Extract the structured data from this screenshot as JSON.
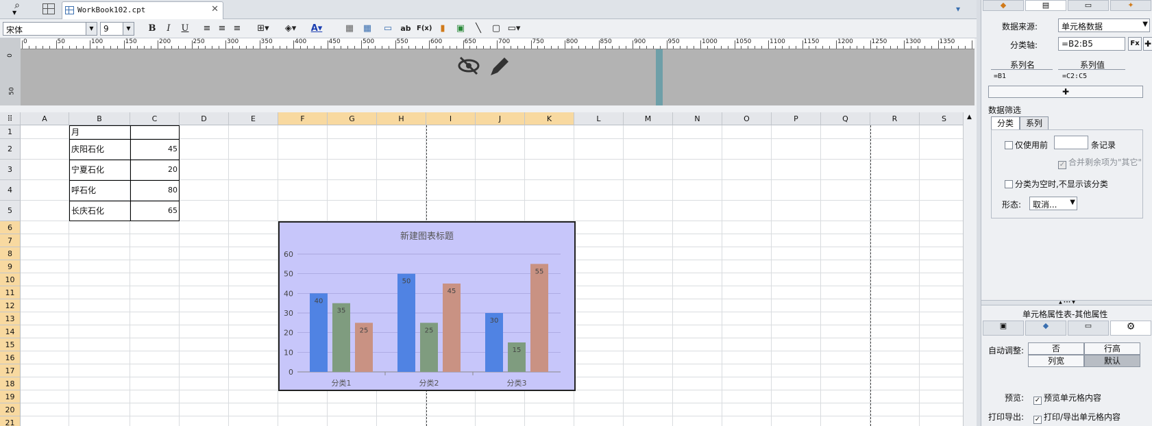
{
  "tab": {
    "title": "WorkBook102.cpt"
  },
  "toolbar": {
    "font": "宋体",
    "font_size": "9",
    "bold": "B",
    "italic": "I",
    "underline": "U",
    "text_ab": "ab",
    "formula": "F(x)"
  },
  "ruler": {
    "labels": [
      "0",
      "50",
      "100",
      "150",
      "200",
      "250",
      "300",
      "350",
      "400",
      "450",
      "500",
      "550",
      "600",
      "650",
      "700",
      "750",
      "800",
      "850",
      "900",
      "950",
      "1000",
      "1050",
      "1100",
      "1150",
      "1200",
      "1250",
      "1300",
      "1350"
    ],
    "v_labels": [
      "0",
      "50"
    ]
  },
  "columns": [
    "A",
    "B",
    "C",
    "D",
    "E",
    "F",
    "G",
    "H",
    "I",
    "J",
    "K",
    "L",
    "M",
    "N",
    "O",
    "P",
    "Q",
    "R",
    "S"
  ],
  "rows": [
    "1",
    "2",
    "3",
    "4",
    "5",
    "6",
    "7",
    "8",
    "9",
    "10",
    "11",
    "12",
    "13",
    "14",
    "15",
    "16",
    "17",
    "18",
    "19",
    "20",
    "21"
  ],
  "cells": {
    "b1": "月",
    "b2": "庆阳石化",
    "c2": "45",
    "b3": "宁夏石化",
    "c3": "20",
    "b4": "呼石化",
    "c4": "80",
    "b5": "长庆石化",
    "c5": "65"
  },
  "chart_data": {
    "type": "bar",
    "title": "新建图表标题",
    "categories": [
      "分类1",
      "分类2",
      "分类3"
    ],
    "series": [
      {
        "values": [
          40,
          50,
          30
        ],
        "color": "#5083e3"
      },
      {
        "values": [
          35,
          25,
          15
        ],
        "color": "#7f9c7f"
      },
      {
        "values": [
          25,
          45,
          55
        ],
        "color": "#c99283"
      }
    ],
    "ylim": [
      0,
      60
    ],
    "yticks": [
      "0",
      "10",
      "20",
      "30",
      "40",
      "50",
      "60"
    ],
    "background": "#c7c6fa",
    "grid": true
  },
  "panel": {
    "data_source_label": "数据来源:",
    "data_source_value": "单元格数据",
    "category_axis_label": "分类轴:",
    "category_axis_value": "=B2:B5",
    "fx": "Fx",
    "series_name_header": "系列名",
    "series_value_header": "系列值",
    "series_name": "=B1",
    "series_value": "=C2:C5",
    "filter_title": "数据筛选",
    "tab_category": "分类",
    "tab_series": "系列",
    "only_use_first": "仅使用前",
    "records": "条记录",
    "merge_rest": "合并剩余项为\"其它\"",
    "hide_empty": "分类为空时,不显示该分类",
    "form_label": "形态:",
    "form_value": "取消...",
    "props_title": "单元格属性表-其他属性",
    "auto_adjust": "自动调整:",
    "opt_no": "否",
    "opt_row_height": "行高",
    "opt_col_width": "列宽",
    "opt_default": "默认",
    "preview_label": "预览:",
    "preview_check": "预览单元格内容",
    "print_label": "打印导出:",
    "print_check": "打印/导出单元格内容"
  }
}
